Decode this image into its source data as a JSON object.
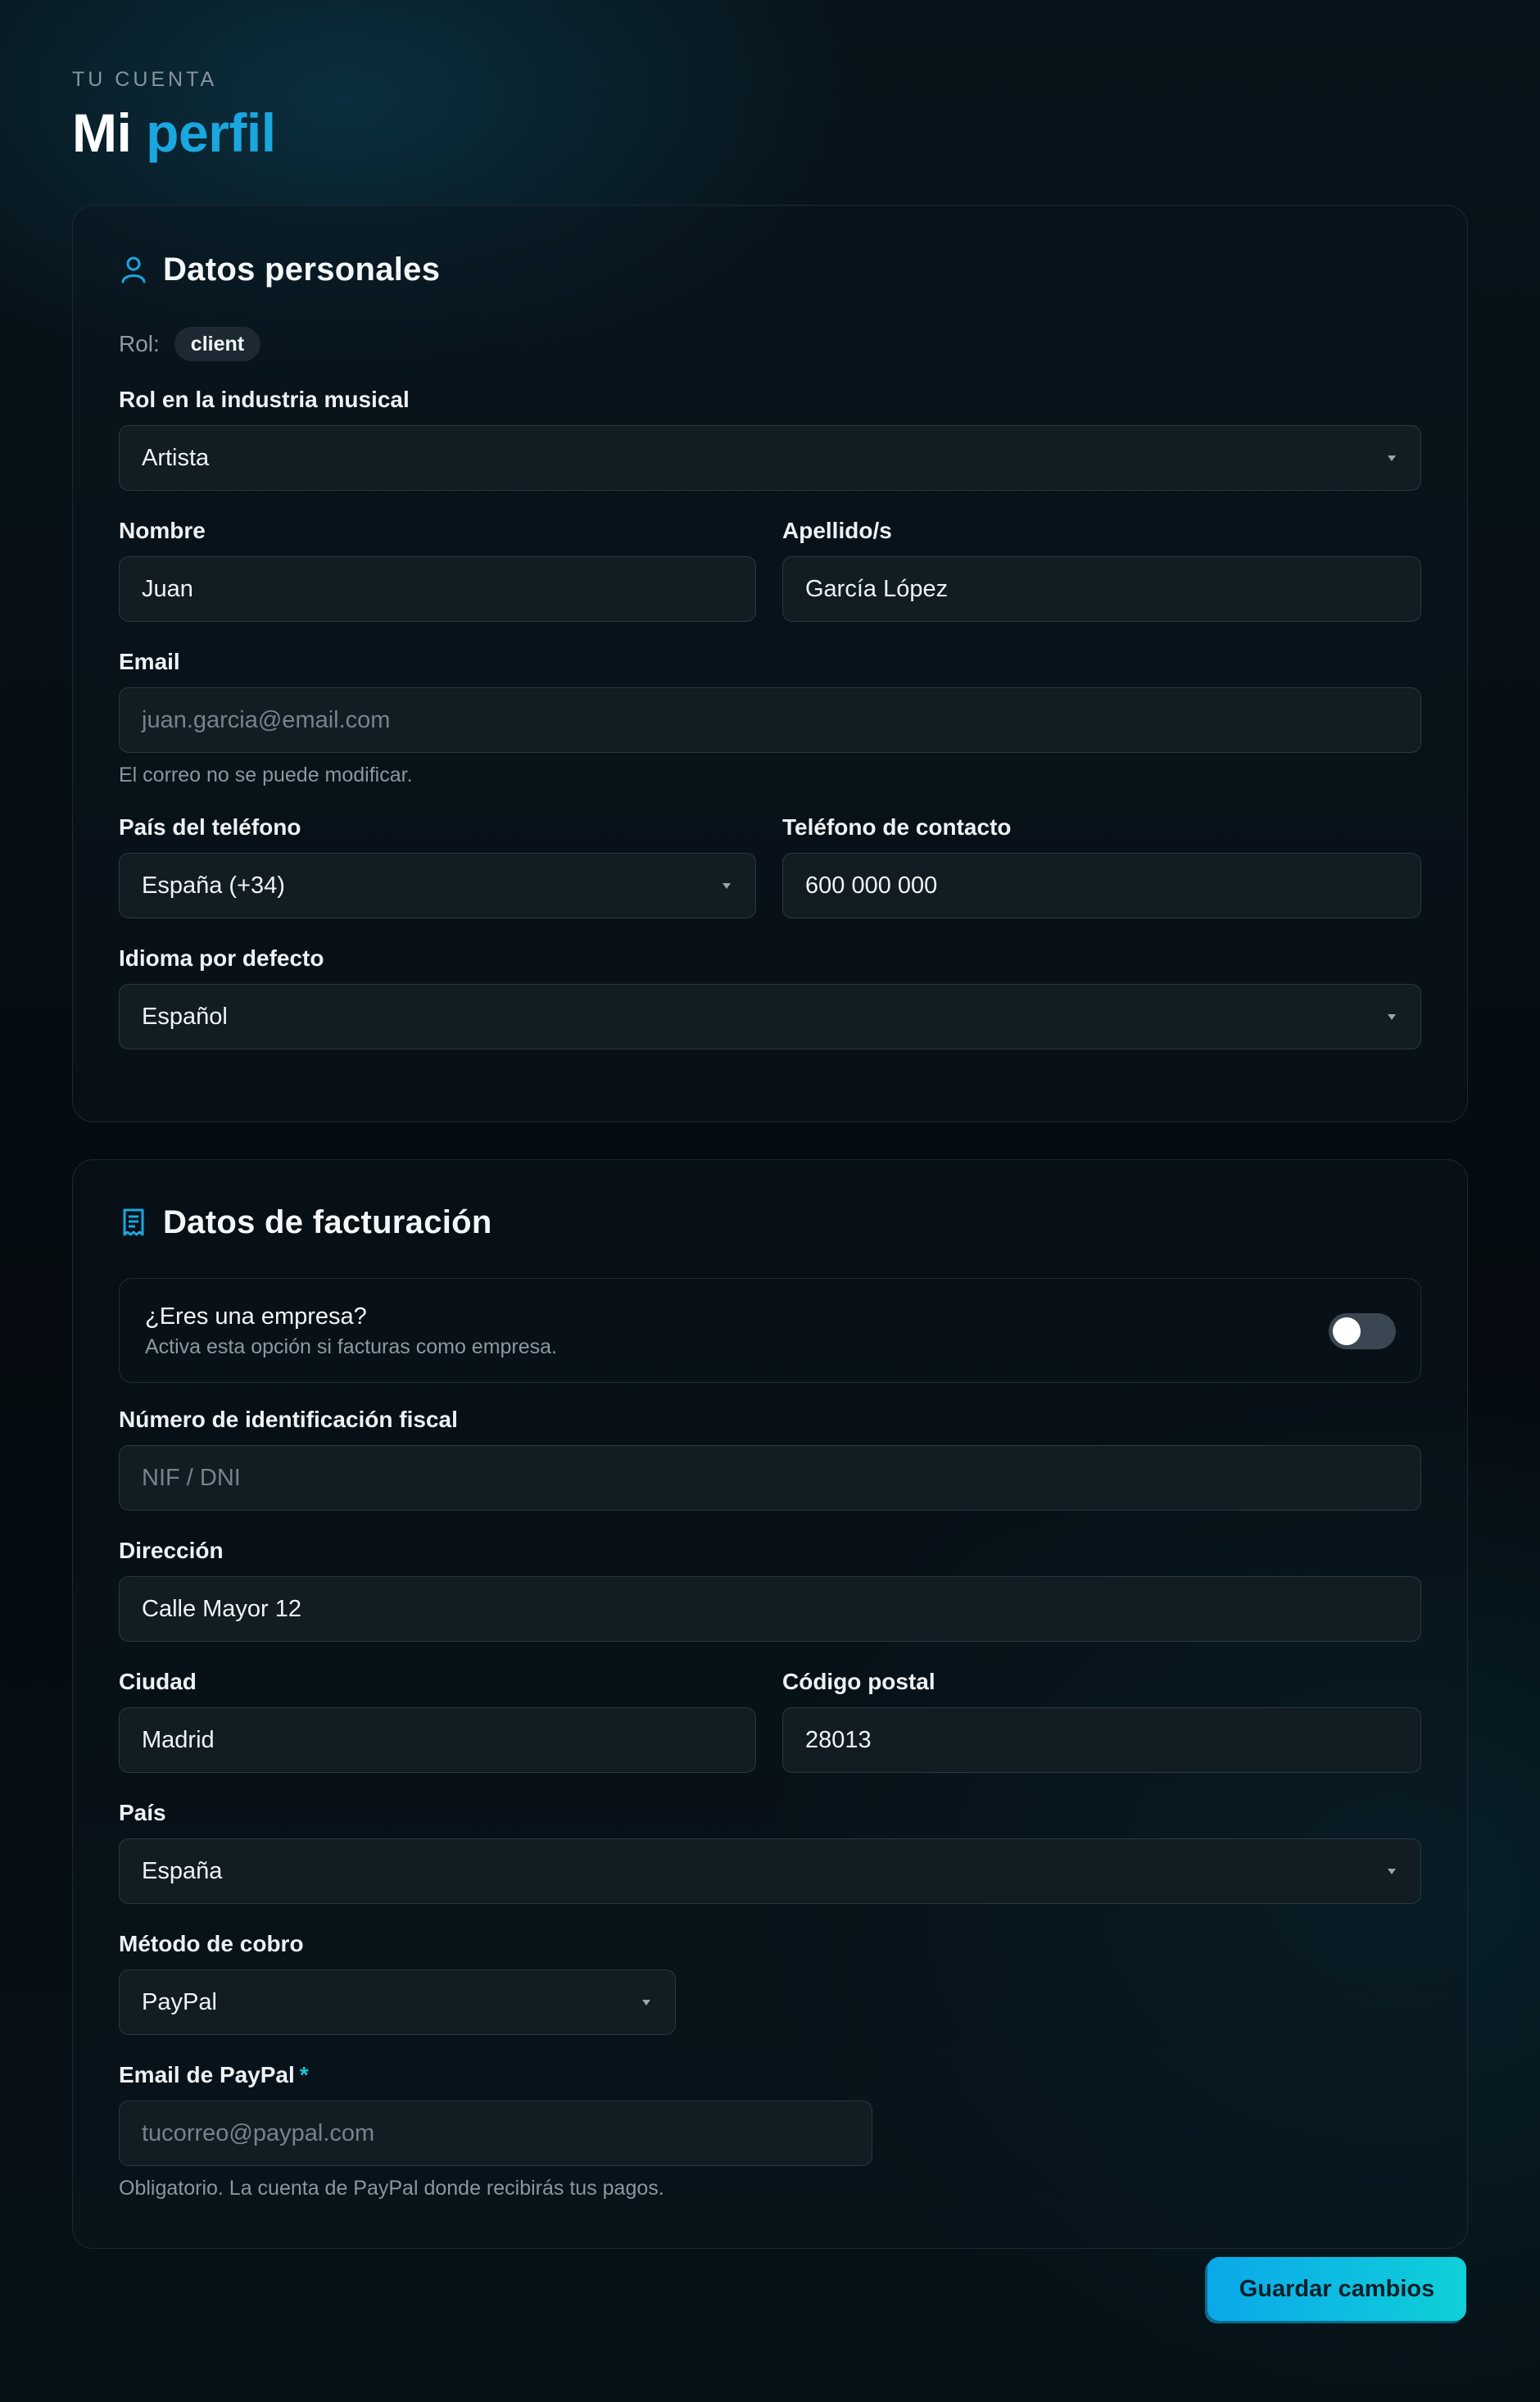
{
  "header": {
    "eyebrow": "TU CUENTA",
    "title_plain": "Mi",
    "title_accent": "perfil"
  },
  "colors": {
    "accent": "#1aa7e0",
    "button_start": "#0aa8ea",
    "button_end": "#0fd0d8",
    "required": "#19c7d6"
  },
  "personal": {
    "icon": "user-icon",
    "heading": "Datos personales",
    "role_label": "Rol:",
    "role_value": "client",
    "industry_role": {
      "label": "Rol en la industria musical",
      "value": "Artista"
    },
    "first_name": {
      "label": "Nombre",
      "value": "Juan"
    },
    "last_name": {
      "label": "Apellido/s",
      "value": "García López"
    },
    "email": {
      "label": "Email",
      "value": "juan.garcia@email.com",
      "hint": "El correo no se puede modificar."
    },
    "phone_country": {
      "label": "País del teléfono",
      "value": "España (+34)"
    },
    "phone": {
      "label": "Teléfono de contacto",
      "value": "600 000 000"
    },
    "language": {
      "label": "Idioma por defecto",
      "value": "Español"
    }
  },
  "billing": {
    "icon": "receipt-icon",
    "heading": "Datos de facturación",
    "company_toggle": {
      "title": "¿Eres una empresa?",
      "subtitle": "Activa esta opción si facturas como empresa.",
      "on": false
    },
    "tax_id": {
      "label": "Número de identificación fiscal",
      "placeholder": "NIF / DNI"
    },
    "address": {
      "label": "Dirección",
      "value": "Calle Mayor 12"
    },
    "city": {
      "label": "Ciudad",
      "value": "Madrid"
    },
    "postal_code": {
      "label": "Código postal",
      "value": "28013"
    },
    "country": {
      "label": "País",
      "value": "España"
    },
    "payout_method": {
      "label": "Método de cobro",
      "value": "PayPal"
    },
    "paypal_email": {
      "label": "Email de PayPal",
      "required_mark": "*",
      "placeholder": "tucorreo@paypal.com",
      "hint": "Obligatorio. La cuenta de PayPal donde recibirás tus pagos."
    }
  },
  "actions": {
    "save_label": "Guardar cambios"
  }
}
